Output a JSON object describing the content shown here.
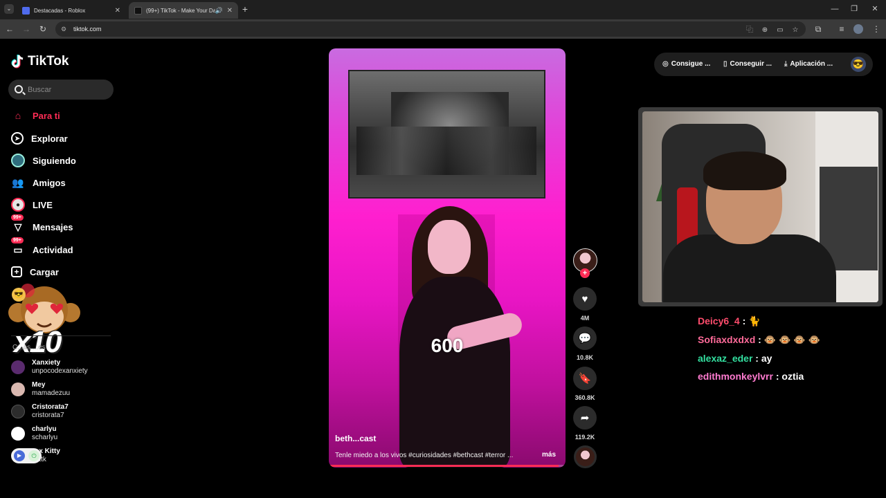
{
  "browser": {
    "tabs": [
      {
        "title": "Destacadas - Roblox",
        "active": false,
        "favicon_color": "#4f6bed"
      },
      {
        "title": "(99+) TikTok - Make Your Da",
        "active": true,
        "favicon_color": "#111111"
      }
    ],
    "new_tab_icon": "plus-icon",
    "window_controls": [
      "minimize-icon",
      "restore-icon",
      "close-icon"
    ],
    "address": "tiktok.com",
    "address_icons": [
      "translate-icon",
      "zoom-icon",
      "cast-icon",
      "star-icon",
      "extensions-icon",
      "media-icon",
      "profile-icon",
      "menu-icon"
    ]
  },
  "sidebar": {
    "logo": "TikTok",
    "search_placeholder": "Buscar",
    "nav": [
      {
        "label": "Para ti",
        "icon": "home-icon",
        "active": true,
        "badge": ""
      },
      {
        "label": "Explorar",
        "icon": "compass-icon",
        "active": false,
        "badge": ""
      },
      {
        "label": "Siguiendo",
        "icon": "following-avatar-icon",
        "active": false,
        "badge": ""
      },
      {
        "label": "Amigos",
        "icon": "friends-icon",
        "active": false,
        "badge": ""
      },
      {
        "label": "LIVE",
        "icon": "live-icon",
        "active": false,
        "badge": ""
      },
      {
        "label": "Mensajes",
        "icon": "messages-icon",
        "active": false,
        "badge": "99+"
      },
      {
        "label": "Actividad",
        "icon": "activity-icon",
        "active": false,
        "badge": "99+"
      },
      {
        "label": "Cargar",
        "icon": "upload-icon",
        "active": false,
        "badge": ""
      }
    ],
    "following_title": "C...as ...es",
    "accounts": [
      {
        "name": "Xanxiety",
        "handle": "unpocodexanxiety",
        "avatar_color": "#5a2b6e"
      },
      {
        "name": "Mey",
        "handle": "mamadezuu",
        "avatar_color": "#d9b8b0"
      },
      {
        "name": "Cristorata7",
        "handle": "cristorata7",
        "avatar_color": "#2c2c2c"
      },
      {
        "name": "charlyu",
        "handle": "scharlyu",
        "avatar_color": "#ffffff"
      },
      {
        "name": "...x Kitty",
        "handle": "...ttk",
        "avatar_color": "#4a6bd8"
      }
    ],
    "overlay_text": "x10"
  },
  "video": {
    "author": "beth...cast",
    "description": "Tenle miedo a los vivos #curiosidades #bethcast #terror ...",
    "more_label": "más",
    "counter": "600",
    "progress": 0.97,
    "accent": "#fe2c55"
  },
  "rail": {
    "like_count": "4M",
    "comment_count": "10.8K",
    "save_count": "360.8K",
    "share_count": "119.2K"
  },
  "top_actions": [
    {
      "label": "Consigue ...",
      "icon": "coin-icon"
    },
    {
      "label": "Conseguir ...",
      "icon": "phone-icon"
    },
    {
      "label": "Aplicación ...",
      "icon": "download-icon"
    }
  ],
  "chat": [
    {
      "user": "Deicy6_4",
      "user_color": "#ff4d6d",
      "message": "🐈"
    },
    {
      "user": "Sofiaxdxdxd",
      "user_color": "#ff6b9a",
      "message": "🐵 🐵 🐵 🐵"
    },
    {
      "user": "alexaz_eder",
      "user_color": "#33e0a0",
      "message": "ay"
    },
    {
      "user": "edithmonkeylvrr",
      "user_color": "#ff7bd0",
      "message": "oztia"
    }
  ]
}
